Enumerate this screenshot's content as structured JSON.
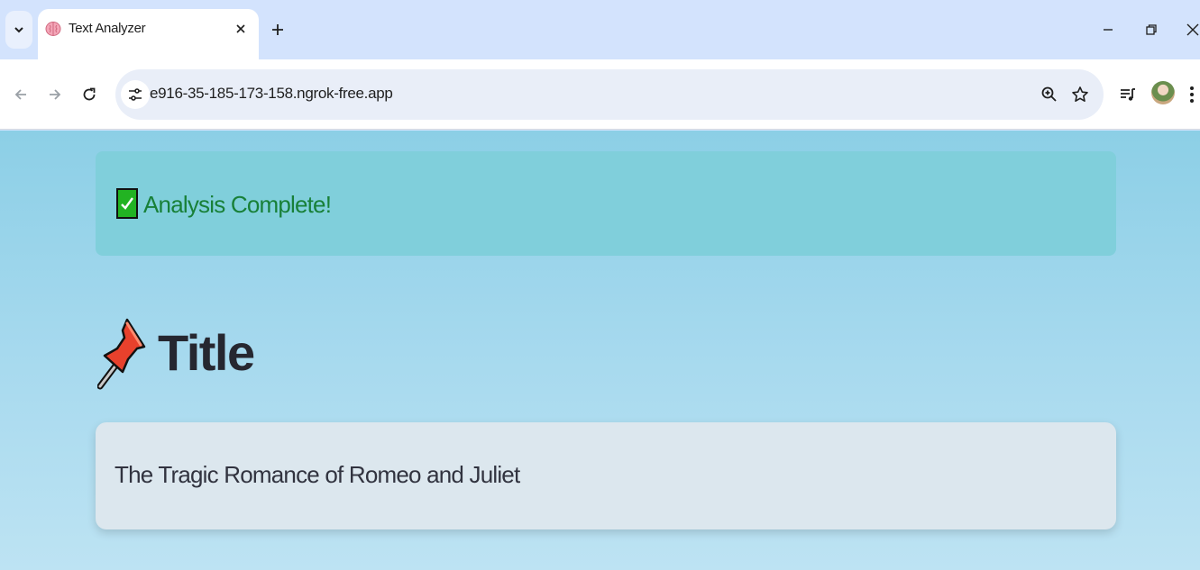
{
  "browser": {
    "tab": {
      "title": "Text Analyzer",
      "favicon": "brain-icon"
    },
    "address_bar": {
      "url": "e916-35-185-173-158.ngrok-free.app"
    }
  },
  "page": {
    "status": {
      "icon": "check-mark-icon",
      "text": "Analysis Complete!",
      "color": "#188038"
    },
    "section": {
      "icon": "pushpin-icon",
      "heading": "Title"
    },
    "title_card": {
      "text": "The Tragic Romance of Romeo and Juliet"
    }
  },
  "colors": {
    "tabstrip_bg": "#d3e3fd",
    "page_gradient_top": "#8ccfe6",
    "page_gradient_bottom": "#bde3f3",
    "success_box_bg": "#80cfdb",
    "card_bg": "#dce7ee"
  }
}
